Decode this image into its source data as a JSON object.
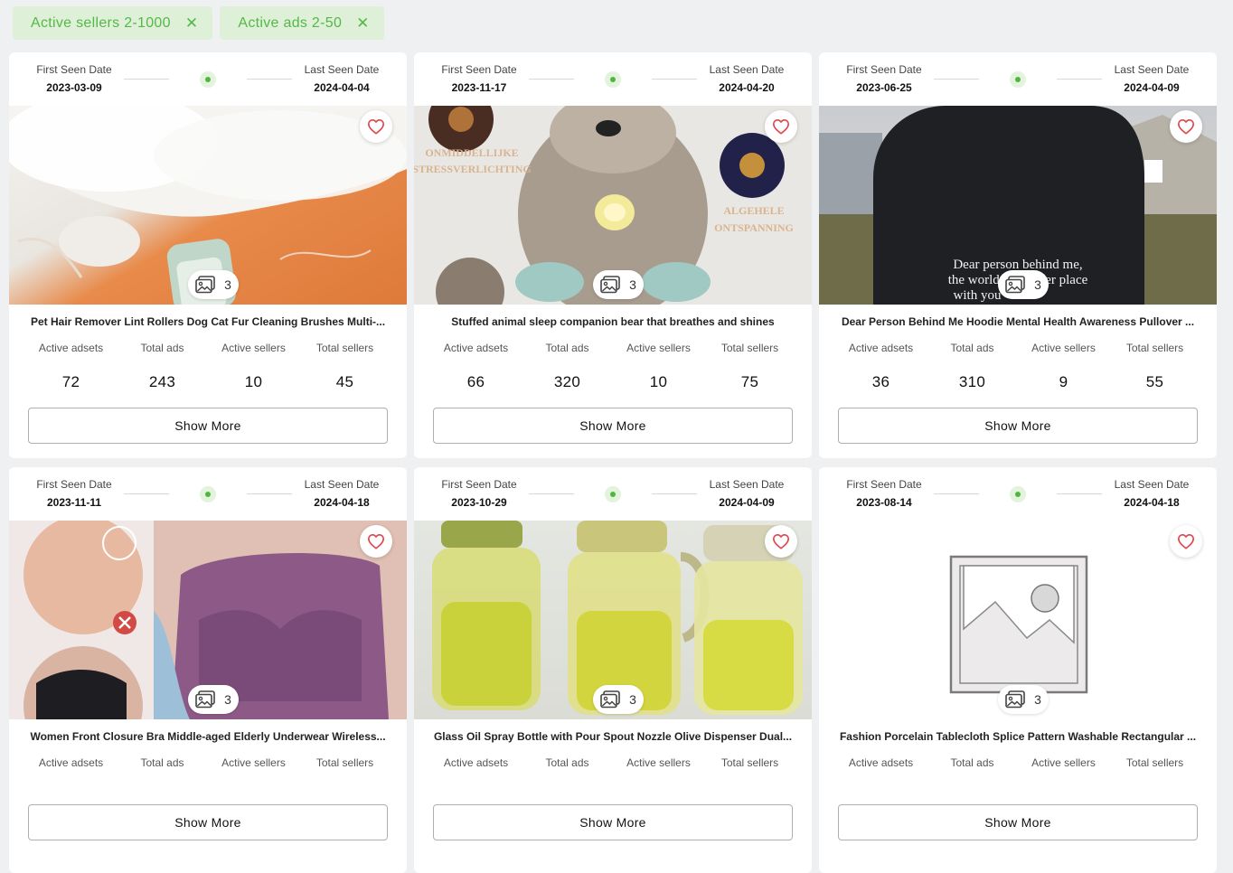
{
  "filters": [
    {
      "label": "Active sellers 2-1000"
    },
    {
      "label": "Active ads 2-50"
    }
  ],
  "labels": {
    "first_seen": "First Seen Date",
    "last_seen": "Last Seen Date",
    "active_adsets": "Active adsets",
    "total_ads": "Total ads",
    "active_sellers": "Active sellers",
    "total_sellers": "Total sellers",
    "show_more": "Show More"
  },
  "colors": {
    "accent": "#54b847",
    "chip_bg": "#dff0d9",
    "heart": "#e0454d"
  },
  "icons": {
    "remove": "close-icon",
    "favorite": "heart-icon",
    "gallery": "image-icon"
  },
  "cards": [
    {
      "first_seen": "2023-03-09",
      "last_seen": "2024-04-04",
      "image_count": "3",
      "title": "Pet Hair Remover Lint Rollers Dog Cat Fur Cleaning Brushes Multi-...",
      "active_adsets": "72",
      "total_ads": "243",
      "active_sellers": "10",
      "total_sellers": "45"
    },
    {
      "first_seen": "2023-11-17",
      "last_seen": "2024-04-20",
      "image_count": "3",
      "title": "Stuffed animal sleep companion bear that breathes and shines",
      "active_adsets": "66",
      "total_ads": "320",
      "active_sellers": "10",
      "total_sellers": "75",
      "image_text": [
        "ONMIDDELLIJKE",
        "STRESSVERLICHTING",
        "ALGEHELE",
        "ONTSPANNING"
      ]
    },
    {
      "first_seen": "2023-06-25",
      "last_seen": "2024-04-09",
      "image_count": "3",
      "title": "Dear Person Behind Me Hoodie Mental Health Awareness Pullover ...",
      "active_adsets": "36",
      "total_ads": "310",
      "active_sellers": "9",
      "total_sellers": "55",
      "image_text": [
        "Dear person behind me,",
        "the world is a better place",
        "with you"
      ]
    },
    {
      "first_seen": "2023-11-11",
      "last_seen": "2024-04-18",
      "image_count": "3",
      "title": "Women Front Closure Bra Middle-aged Elderly Underwear Wireless...",
      "active_adsets": "",
      "total_ads": "",
      "active_sellers": "",
      "total_sellers": ""
    },
    {
      "first_seen": "2023-10-29",
      "last_seen": "2024-04-09",
      "image_count": "3",
      "title": "Glass Oil Spray Bottle with Pour Spout Nozzle Olive Dispenser Dual...",
      "active_adsets": "",
      "total_ads": "",
      "active_sellers": "",
      "total_sellers": ""
    },
    {
      "first_seen": "2023-08-14",
      "last_seen": "2024-04-18",
      "image_count": "3",
      "title": "Fashion Porcelain Tablecloth Splice Pattern Washable Rectangular ...",
      "active_adsets": "",
      "total_ads": "",
      "active_sellers": "",
      "total_sellers": ""
    }
  ]
}
